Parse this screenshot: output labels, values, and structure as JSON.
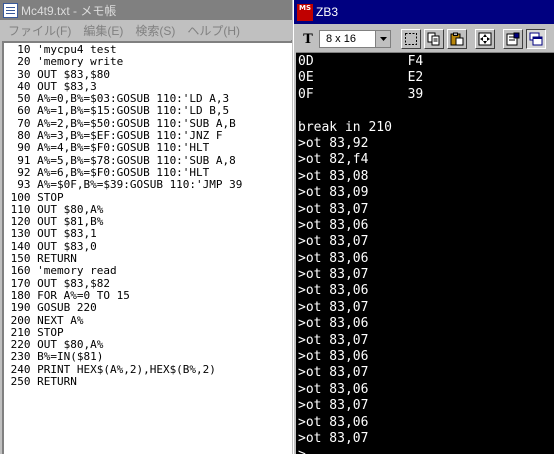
{
  "notepad": {
    "title": "Mc4t9.txt - メモ帳",
    "menu": [
      "ファイル(F)",
      "編集(E)",
      "検索(S)",
      "ヘルプ(H)"
    ],
    "lines": [
      "  10 'mycpu4 test",
      "  20 'memory write",
      "  30 OUT $83,$80",
      "  40 OUT $83,3",
      "  50 A%=0,B%=$03:GOSUB 110:'LD A,3",
      "  60 A%=1,B%=$15:GOSUB 110:'LD B,5",
      "  70 A%=2,B%=$50:GOSUB 110:'SUB A,B",
      "  80 A%=3,B%=$EF:GOSUB 110:'JNZ F",
      "  90 A%=4,B%=$F0:GOSUB 110:'HLT",
      "  91 A%=5,B%=$78:GOSUB 110:'SUB A,8",
      "  92 A%=6,B%=$F0:GOSUB 110:'HLT",
      "  93 A%=$0F,B%=$39:GOSUB 110:'JMP 39",
      " 100 STOP",
      " 110 OUT $80,A%",
      " 120 OUT $81,B%",
      " 130 OUT $83,1",
      " 140 OUT $83,0",
      " 150 RETURN",
      " 160 'memory read",
      " 170 OUT $83,$82",
      " 180 FOR A%=0 TO 15",
      " 190 GOSUB 220",
      " 200 NEXT A%",
      " 210 STOP",
      " 220 OUT $80,A%",
      " 230 B%=IN($81)",
      " 240 PRINT HEX$(A%,2),HEX$(B%,2)",
      " 250 RETURN"
    ]
  },
  "terminal": {
    "title": "ZB3",
    "icon_text": "MS",
    "font_icon": "T",
    "font_size_label": "8 x 16",
    "toolbar_icons": [
      "select-icon",
      "copy-icon",
      "paste-icon",
      "fullscreen-icon",
      "properties-icon",
      "background-icon"
    ],
    "lines": [
      "0D            F4",
      "0E            E2",
      "0F            39",
      "",
      "break in 210",
      ">ot 83,92",
      ">ot 82,f4",
      ">ot 83,08",
      ">ot 83,09",
      ">ot 83,07",
      ">ot 83,06",
      ">ot 83,07",
      ">ot 83,06",
      ">ot 83,07",
      ">ot 83,06",
      ">ot 83,07",
      ">ot 83,06",
      ">ot 83,07",
      ">ot 83,06",
      ">ot 83,07",
      ">ot 83,06",
      ">ot 83,07",
      ">ot 83,06",
      ">ot 83,07",
      ">"
    ]
  },
  "colors": {
    "terminal_title_bg": "#000080",
    "notepad_title_bg": "#808080",
    "terminal_bg": "#000000",
    "terminal_text": "#ffffff"
  }
}
